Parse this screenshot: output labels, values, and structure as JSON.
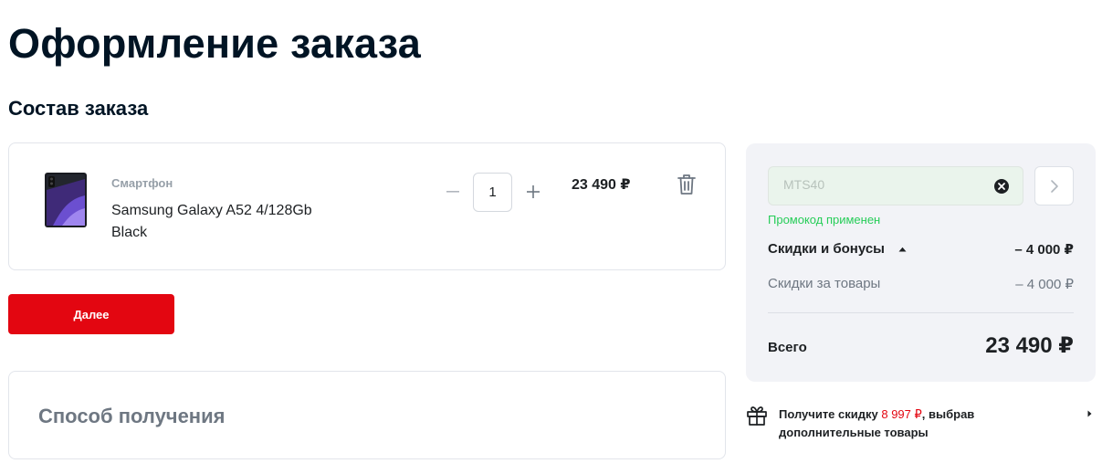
{
  "page": {
    "title": "Оформление заказа"
  },
  "order": {
    "section_title": "Состав заказа",
    "items": [
      {
        "category": "Смартфон",
        "name": "Samsung Galaxy A52 4/128Gb Black",
        "quantity": "1",
        "price": "23 490 ₽"
      }
    ]
  },
  "actions": {
    "next_label": "Далее"
  },
  "delivery": {
    "title": "Способ получения"
  },
  "summary": {
    "promo_code_value": "MTS40",
    "promo_status": "Промокод применен",
    "discounts_label": "Скидки и бонусы",
    "discounts_value": "– 4 000 ₽",
    "item_discount_label": "Скидки за товары",
    "item_discount_value": "– 4 000 ₽",
    "total_label": "Всего",
    "total_value": "23 490 ₽"
  },
  "gift": {
    "text_before": "Получите скидку ",
    "amount": "8 997 ₽",
    "text_after": ", выбрав дополнительные товары"
  },
  "colors": {
    "brand_red": "#e30611",
    "success_green": "#26cd58",
    "panel_bg": "#f2f3f7",
    "heading": "#001424"
  },
  "icons": {
    "quantity_minus": "minus-icon",
    "quantity_plus": "plus-icon",
    "remove_item": "trash-icon",
    "promo_clear": "close-circle-icon",
    "promo_submit": "chevron-right-icon",
    "discounts_toggle": "caret-up-icon",
    "gift": "gift-icon",
    "gift_link": "caret-right-icon"
  }
}
